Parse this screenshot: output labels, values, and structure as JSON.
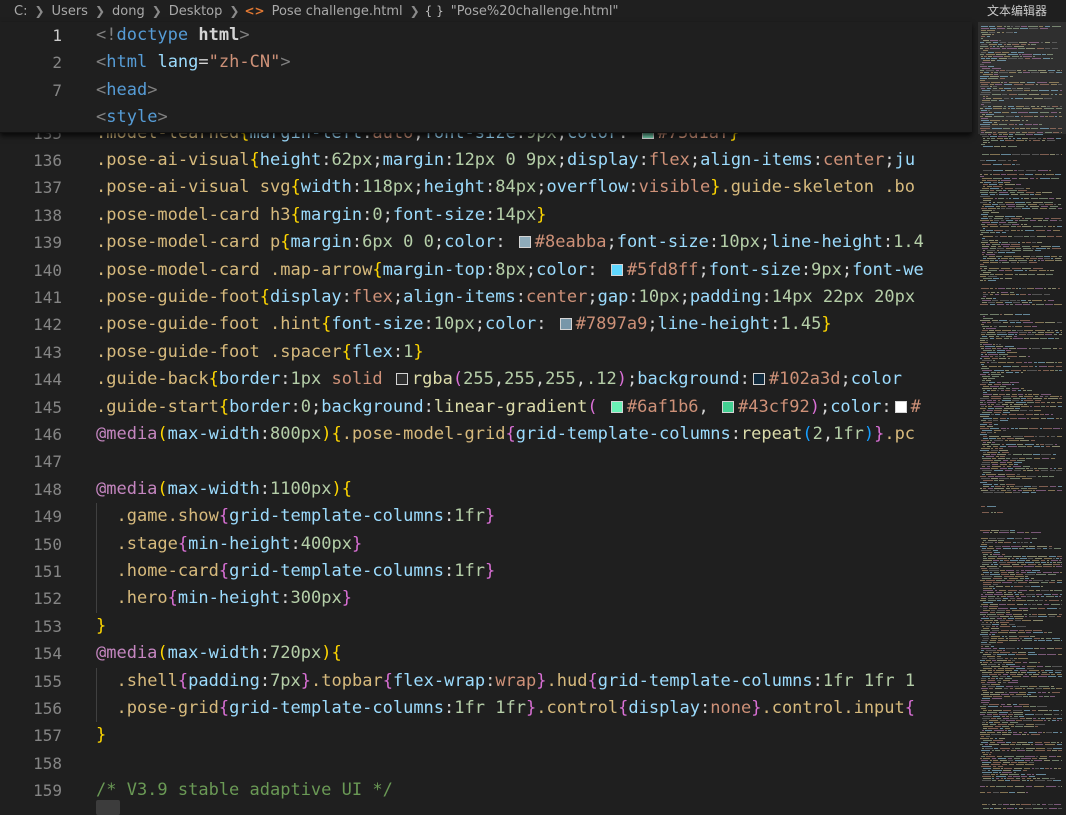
{
  "breadcrumb": {
    "parts": [
      "C:",
      "Users",
      "dong",
      "Desktop"
    ],
    "file": "Pose challenge.html",
    "symbol": "\"Pose%20challenge.html\""
  },
  "minimap": {
    "label": "文本编辑器"
  },
  "icons": {
    "file": "html-file-icon",
    "symbol": "braces-icon",
    "chevron": "chevron-right-icon"
  },
  "colors": {
    "background": "#1f1f1f",
    "selector": "#d7ba7d",
    "property": "#9cdcfe",
    "value": "#ce9178",
    "number": "#b5cea8",
    "at_rule": "#c586c0",
    "comment": "#6a9955",
    "swatch_8eabba": "#8eabba",
    "swatch_5fd8ff": "#5fd8ff",
    "swatch_7897a9": "#7897a9",
    "swatch_rgba_white": "#2e2e2e",
    "swatch_102a3d": "#102a3d",
    "swatch_6af1b6": "#6af1b6",
    "swatch_43cf92": "#43cf92",
    "swatch_white": "#ffffff",
    "swatch_75d1af": "#75d1af"
  },
  "sticky": [
    {
      "n": "1",
      "t": [
        [
          "punct",
          "<!"
        ],
        [
          "tag",
          "doctype"
        ],
        [
          "text",
          " "
        ],
        [
          "bold",
          "html"
        ],
        [
          "punct",
          ">"
        ]
      ]
    },
    {
      "n": "2",
      "t": [
        [
          "punct",
          "<"
        ],
        [
          "tag",
          "html"
        ],
        [
          "text",
          " "
        ],
        [
          "attr",
          "lang"
        ],
        [
          "text",
          "="
        ],
        [
          "str",
          "\"zh-CN\""
        ],
        [
          "punct",
          ">"
        ]
      ]
    },
    {
      "n": "7",
      "t": [
        [
          "punct",
          "<"
        ],
        [
          "tag",
          "head"
        ],
        [
          "punct",
          ">"
        ]
      ]
    },
    {
      "n": "",
      "t": [
        [
          "punct",
          "<"
        ],
        [
          "tag",
          "style"
        ],
        [
          "punct",
          ">"
        ]
      ]
    }
  ],
  "lines": [
    {
      "n": "135",
      "t": [
        [
          "sel",
          ".model-learned"
        ],
        [
          "br1",
          "{"
        ],
        [
          "prop",
          "margin-left"
        ],
        [
          "text",
          ":"
        ],
        [
          "val",
          "auto"
        ],
        [
          "text",
          ";"
        ],
        [
          "prop",
          "font-size"
        ],
        [
          "text",
          ":"
        ],
        [
          "num",
          "9px"
        ],
        [
          "text",
          ";"
        ],
        [
          "prop",
          "color"
        ],
        [
          "text",
          ": "
        ],
        [
          "sw",
          "swatch_75d1af"
        ],
        [
          "val",
          "#75d1af"
        ],
        [
          "br1",
          "}"
        ]
      ]
    },
    {
      "n": "136",
      "t": [
        [
          "sel",
          ".pose-ai-visual"
        ],
        [
          "br1",
          "{"
        ],
        [
          "prop",
          "height"
        ],
        [
          "text",
          ":"
        ],
        [
          "num",
          "62px"
        ],
        [
          "text",
          ";"
        ],
        [
          "prop",
          "margin"
        ],
        [
          "text",
          ":"
        ],
        [
          "num",
          "12px"
        ],
        [
          "text",
          " "
        ],
        [
          "num",
          "0"
        ],
        [
          "text",
          " "
        ],
        [
          "num",
          "9px"
        ],
        [
          "text",
          ";"
        ],
        [
          "prop",
          "display"
        ],
        [
          "text",
          ":"
        ],
        [
          "val",
          "flex"
        ],
        [
          "text",
          ";"
        ],
        [
          "prop",
          "align-items"
        ],
        [
          "text",
          ":"
        ],
        [
          "val",
          "center"
        ],
        [
          "text",
          ";"
        ],
        [
          "prop",
          "ju"
        ]
      ]
    },
    {
      "n": "137",
      "t": [
        [
          "sel",
          ".pose-ai-visual svg"
        ],
        [
          "br1",
          "{"
        ],
        [
          "prop",
          "width"
        ],
        [
          "text",
          ":"
        ],
        [
          "num",
          "118px"
        ],
        [
          "text",
          ";"
        ],
        [
          "prop",
          "height"
        ],
        [
          "text",
          ":"
        ],
        [
          "num",
          "84px"
        ],
        [
          "text",
          ";"
        ],
        [
          "prop",
          "overflow"
        ],
        [
          "text",
          ":"
        ],
        [
          "val",
          "visible"
        ],
        [
          "br1",
          "}"
        ],
        [
          "sel",
          ".guide-skeleton .bo"
        ]
      ]
    },
    {
      "n": "138",
      "t": [
        [
          "sel",
          ".pose-model-card h3"
        ],
        [
          "br1",
          "{"
        ],
        [
          "prop",
          "margin"
        ],
        [
          "text",
          ":"
        ],
        [
          "num",
          "0"
        ],
        [
          "text",
          ";"
        ],
        [
          "prop",
          "font-size"
        ],
        [
          "text",
          ":"
        ],
        [
          "num",
          "14px"
        ],
        [
          "br1",
          "}"
        ]
      ]
    },
    {
      "n": "139",
      "t": [
        [
          "sel",
          ".pose-model-card p"
        ],
        [
          "br1",
          "{"
        ],
        [
          "prop",
          "margin"
        ],
        [
          "text",
          ":"
        ],
        [
          "num",
          "6px"
        ],
        [
          "text",
          " "
        ],
        [
          "num",
          "0"
        ],
        [
          "text",
          " "
        ],
        [
          "num",
          "0"
        ],
        [
          "text",
          ";"
        ],
        [
          "prop",
          "color"
        ],
        [
          "text",
          ": "
        ],
        [
          "sw",
          "swatch_8eabba"
        ],
        [
          "val",
          "#8eabba"
        ],
        [
          "text",
          ";"
        ],
        [
          "prop",
          "font-size"
        ],
        [
          "text",
          ":"
        ],
        [
          "num",
          "10px"
        ],
        [
          "text",
          ";"
        ],
        [
          "prop",
          "line-height"
        ],
        [
          "text",
          ":"
        ],
        [
          "num",
          "1.4"
        ]
      ]
    },
    {
      "n": "140",
      "t": [
        [
          "sel",
          ".pose-model-card .map-arrow"
        ],
        [
          "br1",
          "{"
        ],
        [
          "prop",
          "margin-top"
        ],
        [
          "text",
          ":"
        ],
        [
          "num",
          "8px"
        ],
        [
          "text",
          ";"
        ],
        [
          "prop",
          "color"
        ],
        [
          "text",
          ": "
        ],
        [
          "sw",
          "swatch_5fd8ff"
        ],
        [
          "val",
          "#5fd8ff"
        ],
        [
          "text",
          ";"
        ],
        [
          "prop",
          "font-size"
        ],
        [
          "text",
          ":"
        ],
        [
          "num",
          "9px"
        ],
        [
          "text",
          ";"
        ],
        [
          "prop",
          "font-we"
        ]
      ]
    },
    {
      "n": "141",
      "t": [
        [
          "sel",
          ".pose-guide-foot"
        ],
        [
          "br1",
          "{"
        ],
        [
          "prop",
          "display"
        ],
        [
          "text",
          ":"
        ],
        [
          "val",
          "flex"
        ],
        [
          "text",
          ";"
        ],
        [
          "prop",
          "align-items"
        ],
        [
          "text",
          ":"
        ],
        [
          "val",
          "center"
        ],
        [
          "text",
          ";"
        ],
        [
          "prop",
          "gap"
        ],
        [
          "text",
          ":"
        ],
        [
          "num",
          "10px"
        ],
        [
          "text",
          ";"
        ],
        [
          "prop",
          "padding"
        ],
        [
          "text",
          ":"
        ],
        [
          "num",
          "14px"
        ],
        [
          "text",
          " "
        ],
        [
          "num",
          "22px"
        ],
        [
          "text",
          " "
        ],
        [
          "num",
          "20px"
        ]
      ]
    },
    {
      "n": "142",
      "t": [
        [
          "sel",
          ".pose-guide-foot .hint"
        ],
        [
          "br1",
          "{"
        ],
        [
          "prop",
          "font-size"
        ],
        [
          "text",
          ":"
        ],
        [
          "num",
          "10px"
        ],
        [
          "text",
          ";"
        ],
        [
          "prop",
          "color"
        ],
        [
          "text",
          ": "
        ],
        [
          "sw",
          "swatch_7897a9"
        ],
        [
          "val",
          "#7897a9"
        ],
        [
          "text",
          ";"
        ],
        [
          "prop",
          "line-height"
        ],
        [
          "text",
          ":"
        ],
        [
          "num",
          "1.45"
        ],
        [
          "br1",
          "}"
        ]
      ]
    },
    {
      "n": "143",
      "t": [
        [
          "sel",
          ".pose-guide-foot .spacer"
        ],
        [
          "br1",
          "{"
        ],
        [
          "prop",
          "flex"
        ],
        [
          "text",
          ":"
        ],
        [
          "num",
          "1"
        ],
        [
          "br1",
          "}"
        ]
      ]
    },
    {
      "n": "144",
      "t": [
        [
          "sel",
          ".guide-back"
        ],
        [
          "br1",
          "{"
        ],
        [
          "prop",
          "border"
        ],
        [
          "text",
          ":"
        ],
        [
          "num",
          "1px"
        ],
        [
          "text",
          " "
        ],
        [
          "val",
          "solid"
        ],
        [
          "text",
          " "
        ],
        [
          "sw",
          "swatch_rgba_white"
        ],
        [
          "fn",
          "rgba"
        ],
        [
          "br2",
          "("
        ],
        [
          "num",
          "255"
        ],
        [
          "text",
          ","
        ],
        [
          "num",
          "255"
        ],
        [
          "text",
          ","
        ],
        [
          "num",
          "255"
        ],
        [
          "text",
          ","
        ],
        [
          "num",
          ".12"
        ],
        [
          "br2",
          ")"
        ],
        [
          "text",
          ";"
        ],
        [
          "prop",
          "background"
        ],
        [
          "text",
          ":"
        ],
        [
          "sw",
          "swatch_102a3d"
        ],
        [
          "val",
          "#102a3d"
        ],
        [
          "text",
          ";"
        ],
        [
          "prop",
          "color"
        ]
      ]
    },
    {
      "n": "145",
      "t": [
        [
          "sel",
          ".guide-start"
        ],
        [
          "br1",
          "{"
        ],
        [
          "prop",
          "border"
        ],
        [
          "text",
          ":"
        ],
        [
          "num",
          "0"
        ],
        [
          "text",
          ";"
        ],
        [
          "prop",
          "background"
        ],
        [
          "text",
          ":"
        ],
        [
          "fn",
          "linear-gradient"
        ],
        [
          "br2",
          "("
        ],
        [
          "text",
          " "
        ],
        [
          "sw",
          "swatch_6af1b6"
        ],
        [
          "val",
          "#6af1b6"
        ],
        [
          "text",
          ", "
        ],
        [
          "sw",
          "swatch_43cf92"
        ],
        [
          "val",
          "#43cf92"
        ],
        [
          "br2",
          ")"
        ],
        [
          "text",
          ";"
        ],
        [
          "prop",
          "color"
        ],
        [
          "text",
          ":"
        ],
        [
          "sw",
          "swatch_white"
        ],
        [
          "val",
          "#"
        ]
      ]
    },
    {
      "n": "146",
      "t": [
        [
          "at",
          "@media"
        ],
        [
          "br1",
          "("
        ],
        [
          "prop",
          "max-width"
        ],
        [
          "text",
          ":"
        ],
        [
          "num",
          "800px"
        ],
        [
          "br1",
          ")"
        ],
        [
          "br1",
          "{"
        ],
        [
          "sel",
          ".pose-model-grid"
        ],
        [
          "br2",
          "{"
        ],
        [
          "prop",
          "grid-template-columns"
        ],
        [
          "text",
          ":"
        ],
        [
          "fn",
          "repeat"
        ],
        [
          "br3",
          "("
        ],
        [
          "num",
          "2"
        ],
        [
          "text",
          ","
        ],
        [
          "num",
          "1fr"
        ],
        [
          "br3",
          ")"
        ],
        [
          "br2",
          "}"
        ],
        [
          "sel",
          ".pc"
        ]
      ]
    },
    {
      "n": "147",
      "t": []
    },
    {
      "n": "148",
      "t": [
        [
          "at",
          "@media"
        ],
        [
          "br1",
          "("
        ],
        [
          "prop",
          "max-width"
        ],
        [
          "text",
          ":"
        ],
        [
          "num",
          "1100px"
        ],
        [
          "br1",
          ")"
        ],
        [
          "br1",
          "{"
        ]
      ]
    },
    {
      "n": "149",
      "t": [
        [
          "text",
          "  "
        ],
        [
          "sel",
          ".game.show"
        ],
        [
          "br2",
          "{"
        ],
        [
          "prop",
          "grid-template-columns"
        ],
        [
          "text",
          ":"
        ],
        [
          "num",
          "1fr"
        ],
        [
          "br2",
          "}"
        ]
      ]
    },
    {
      "n": "150",
      "t": [
        [
          "text",
          "  "
        ],
        [
          "sel",
          ".stage"
        ],
        [
          "br2",
          "{"
        ],
        [
          "prop",
          "min-height"
        ],
        [
          "text",
          ":"
        ],
        [
          "num",
          "400px"
        ],
        [
          "br2",
          "}"
        ]
      ]
    },
    {
      "n": "151",
      "t": [
        [
          "text",
          "  "
        ],
        [
          "sel",
          ".home-card"
        ],
        [
          "br2",
          "{"
        ],
        [
          "prop",
          "grid-template-columns"
        ],
        [
          "text",
          ":"
        ],
        [
          "num",
          "1fr"
        ],
        [
          "br2",
          "}"
        ]
      ]
    },
    {
      "n": "152",
      "t": [
        [
          "text",
          "  "
        ],
        [
          "sel",
          ".hero"
        ],
        [
          "br2",
          "{"
        ],
        [
          "prop",
          "min-height"
        ],
        [
          "text",
          ":"
        ],
        [
          "num",
          "300px"
        ],
        [
          "br2",
          "}"
        ]
      ]
    },
    {
      "n": "153",
      "t": [
        [
          "br1",
          "}"
        ]
      ]
    },
    {
      "n": "154",
      "t": [
        [
          "at",
          "@media"
        ],
        [
          "br1",
          "("
        ],
        [
          "prop",
          "max-width"
        ],
        [
          "text",
          ":"
        ],
        [
          "num",
          "720px"
        ],
        [
          "br1",
          ")"
        ],
        [
          "br1",
          "{"
        ]
      ]
    },
    {
      "n": "155",
      "t": [
        [
          "text",
          "  "
        ],
        [
          "sel",
          ".shell"
        ],
        [
          "br2",
          "{"
        ],
        [
          "prop",
          "padding"
        ],
        [
          "text",
          ":"
        ],
        [
          "num",
          "7px"
        ],
        [
          "br2",
          "}"
        ],
        [
          "sel",
          ".topbar"
        ],
        [
          "br2",
          "{"
        ],
        [
          "prop",
          "flex-wrap"
        ],
        [
          "text",
          ":"
        ],
        [
          "val",
          "wrap"
        ],
        [
          "br2",
          "}"
        ],
        [
          "sel",
          ".hud"
        ],
        [
          "br2",
          "{"
        ],
        [
          "prop",
          "grid-template-columns"
        ],
        [
          "text",
          ":"
        ],
        [
          "num",
          "1fr"
        ],
        [
          "text",
          " "
        ],
        [
          "num",
          "1fr"
        ],
        [
          "text",
          " "
        ],
        [
          "num",
          "1"
        ]
      ]
    },
    {
      "n": "156",
      "t": [
        [
          "text",
          "  "
        ],
        [
          "sel",
          ".pose-grid"
        ],
        [
          "br2",
          "{"
        ],
        [
          "prop",
          "grid-template-columns"
        ],
        [
          "text",
          ":"
        ],
        [
          "num",
          "1fr"
        ],
        [
          "text",
          " "
        ],
        [
          "num",
          "1fr"
        ],
        [
          "br2",
          "}"
        ],
        [
          "sel",
          ".control"
        ],
        [
          "br2",
          "{"
        ],
        [
          "prop",
          "display"
        ],
        [
          "text",
          ":"
        ],
        [
          "val",
          "none"
        ],
        [
          "br2",
          "}"
        ],
        [
          "sel",
          ".control.input"
        ],
        [
          "br2",
          "{"
        ]
      ]
    },
    {
      "n": "157",
      "t": [
        [
          "br1",
          "}"
        ]
      ]
    },
    {
      "n": "158",
      "t": []
    },
    {
      "n": "159",
      "t": [
        [
          "cmt",
          "/* V3.9 stable adaptive UI */"
        ]
      ]
    }
  ]
}
